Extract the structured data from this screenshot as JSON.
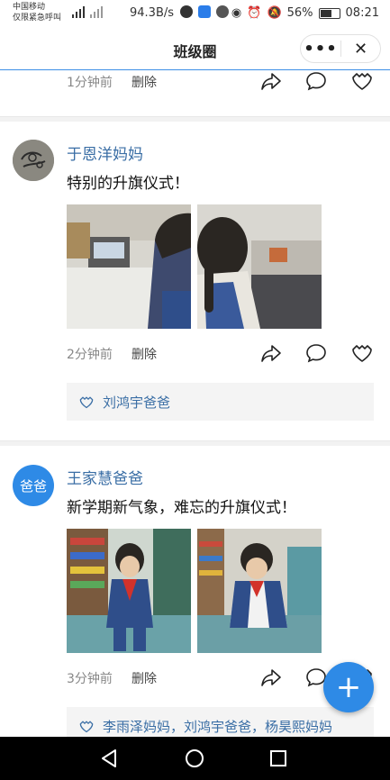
{
  "status": {
    "carrier_line1": "中国移动",
    "carrier_line2": "仅限紧急呼叫",
    "speed": "94.3B/s",
    "battery": "56%",
    "time": "08:21"
  },
  "header": {
    "title": "班级圈",
    "more_label": "•••",
    "close_label": "✕"
  },
  "posts": [
    {
      "time": "1分钟前",
      "delete": "删除"
    },
    {
      "author": "于恩洋妈妈",
      "text": "特别的升旗仪式！",
      "time": "2分钟前",
      "delete": "删除",
      "likes": "刘鸿宇爸爸"
    },
    {
      "author": "王家慧爸爸",
      "avatar_text": "爸爸",
      "text": "新学期新气象，难忘的升旗仪式！",
      "time": "3分钟前",
      "delete": "删除",
      "likes": "李雨泽妈妈，刘鸿宇爸爸，杨昊熙妈妈"
    }
  ],
  "fab_label": "+",
  "colors": {
    "accent": "#2e8ae6",
    "name": "#3a6ea5",
    "like_bg": "#f4f4f4"
  }
}
